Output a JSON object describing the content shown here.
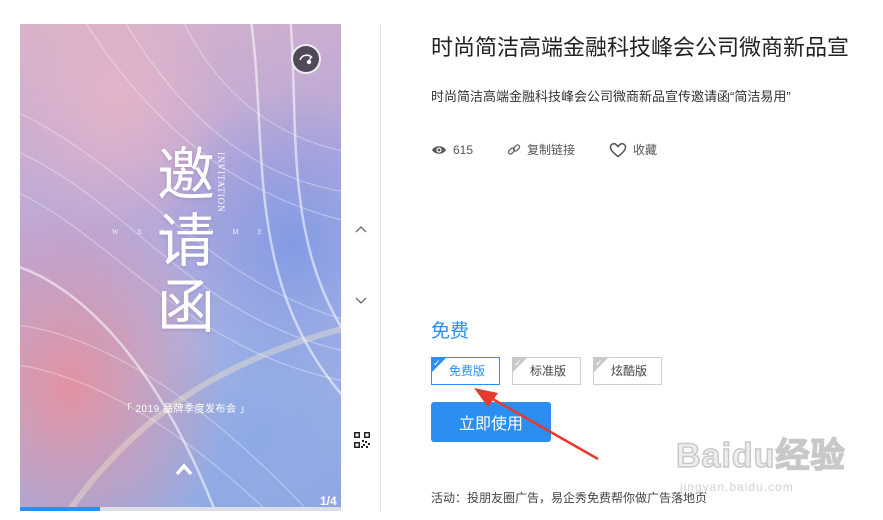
{
  "preview": {
    "title_chars": [
      "邀",
      "请",
      "函"
    ],
    "en_vertical": "INVITATION",
    "welcome_letters": [
      "W",
      "E",
      "L",
      "C",
      "O",
      "M",
      "E"
    ],
    "event_line": "「 2019 品牌季度发布会 」",
    "page_indicator": "1/4",
    "progress_fraction": 0.25,
    "icons": {
      "music": "music-disc-icon",
      "up": "chevron-up-icon"
    }
  },
  "side_controls": {
    "prev_icon": "chevron-up-icon",
    "next_icon": "chevron-down-icon",
    "qr_icon": "qr-code-icon"
  },
  "details": {
    "title": "时尚简洁高端金融科技峰会公司微商新品宣",
    "description": "时尚简洁高端金融科技峰会公司微商新品宣传邀请函“简洁易用”",
    "views": "615",
    "copy_link": "复制链接",
    "favorite": "收藏",
    "price": "免费",
    "editions": [
      {
        "label": "免费版",
        "selected": true
      },
      {
        "label": "标准版",
        "selected": false
      },
      {
        "label": "炫酷版",
        "selected": false
      }
    ],
    "use_button": "立即使用",
    "activity": "活动：投朋友圈广告，易企秀免费帮你做广告落地页"
  },
  "watermark": {
    "text": "Baidu经验",
    "sub": "jingyan.baidu.com"
  },
  "colors": {
    "accent": "#2a8ff0",
    "arrow": "#e8392f",
    "text": "#333333"
  }
}
